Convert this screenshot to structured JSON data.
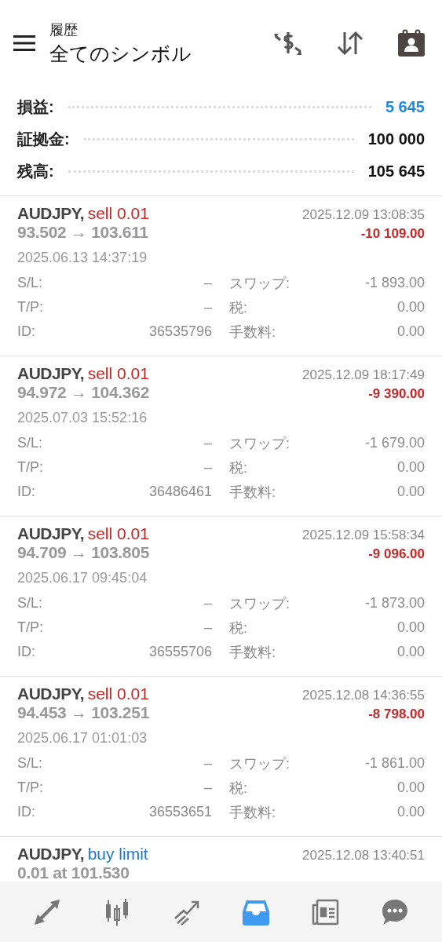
{
  "header": {
    "subtitle": "履歴",
    "title": "全てのシンボル"
  },
  "summary": [
    {
      "label": "損益:",
      "value": "5 645",
      "kind": "highlight"
    },
    {
      "label": "証拠金:",
      "value": "100 000",
      "kind": "plain"
    },
    {
      "label": "残高:",
      "value": "105 645",
      "kind": "plain"
    }
  ],
  "trades": [
    {
      "symbol": "AUDJPY,",
      "type": "sell 0.01",
      "kind": "sell",
      "prices": "93.502 → 103.611",
      "close_time": "2025.12.09 13:08:35",
      "profit": "-10 109.00",
      "open_time": "2025.06.13 14:37:19",
      "fields": [
        {
          "label": "S/L:",
          "value": "–"
        },
        {
          "label": "スワップ:",
          "value": "-1 893.00"
        },
        {
          "label": "T/P:",
          "value": "–"
        },
        {
          "label": "税:",
          "value": "0.00"
        },
        {
          "label": "ID:",
          "value": "36535796"
        },
        {
          "label": "手数料:",
          "value": "0.00"
        }
      ]
    },
    {
      "symbol": "AUDJPY,",
      "type": "sell 0.01",
      "kind": "sell",
      "prices": "94.972 → 104.362",
      "close_time": "2025.12.09 18:17:49",
      "profit": "-9 390.00",
      "open_time": "2025.07.03 15:52:16",
      "fields": [
        {
          "label": "S/L:",
          "value": "–"
        },
        {
          "label": "スワップ:",
          "value": "-1 679.00"
        },
        {
          "label": "T/P:",
          "value": "–"
        },
        {
          "label": "税:",
          "value": "0.00"
        },
        {
          "label": "ID:",
          "value": "36486461"
        },
        {
          "label": "手数料:",
          "value": "0.00"
        }
      ]
    },
    {
      "symbol": "AUDJPY,",
      "type": "sell 0.01",
      "kind": "sell",
      "prices": "94.709 → 103.805",
      "close_time": "2025.12.09 15:58:34",
      "profit": "-9 096.00",
      "open_time": "2025.06.17 09:45:04",
      "fields": [
        {
          "label": "S/L:",
          "value": "–"
        },
        {
          "label": "スワップ:",
          "value": "-1 873.00"
        },
        {
          "label": "T/P:",
          "value": "–"
        },
        {
          "label": "税:",
          "value": "0.00"
        },
        {
          "label": "ID:",
          "value": "36555706"
        },
        {
          "label": "手数料:",
          "value": "0.00"
        }
      ]
    },
    {
      "symbol": "AUDJPY,",
      "type": "sell 0.01",
      "kind": "sell",
      "prices": "94.453 → 103.251",
      "close_time": "2025.12.08 14:36:55",
      "profit": "-8 798.00",
      "open_time": "2025.06.17 01:01:03",
      "fields": [
        {
          "label": "S/L:",
          "value": "–"
        },
        {
          "label": "スワップ:",
          "value": "-1 861.00"
        },
        {
          "label": "T/P:",
          "value": "–"
        },
        {
          "label": "税:",
          "value": "0.00"
        },
        {
          "label": "ID:",
          "value": "36553651"
        },
        {
          "label": "手数料:",
          "value": "0.00"
        }
      ]
    },
    {
      "symbol": "AUDJPY,",
      "type": "buy limit",
      "kind": "buy",
      "prices": "0.01 at 101.530",
      "close_time": "2025.12.08 13:40:51"
    }
  ],
  "nav": [
    {
      "kind": "quotes",
      "selected": false
    },
    {
      "kind": "chart",
      "selected": false
    },
    {
      "kind": "trade",
      "selected": false
    },
    {
      "kind": "history",
      "selected": true
    },
    {
      "kind": "news",
      "selected": false
    },
    {
      "kind": "chat",
      "selected": false
    }
  ]
}
